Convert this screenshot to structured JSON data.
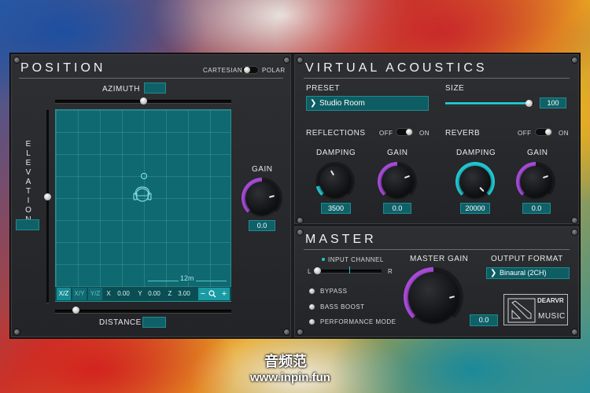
{
  "position": {
    "title": "POSITION",
    "mode_left": "CARTESIAN",
    "mode_right": "POLAR",
    "azimuth_label": "AZIMUTH",
    "azimuth_value": "",
    "elevation_label": "ELEVATION",
    "elevation_value": "",
    "distance_label": "DISTANCE",
    "distance_value": "",
    "gain_label": "GAIN",
    "gain_value": "0.0",
    "grid_scale": "12m",
    "view_buttons": [
      "X/Z",
      "X/Y",
      "Y/Z"
    ],
    "x_label": "X",
    "x_value": "0.00",
    "y_label": "Y",
    "y_value": "0.00",
    "z_label": "Z",
    "z_value": "3.00",
    "zoom_minus": "−",
    "zoom_icon": "magnifier-icon",
    "zoom_plus": "+"
  },
  "acoustics": {
    "title": "VIRTUAL ACOUSTICS",
    "preset_label": "PRESET",
    "preset_value": "Studio Room",
    "size_label": "SIZE",
    "size_value": "100",
    "size_fraction": 0.95,
    "reflections_label": "REFLECTIONS",
    "reverb_label": "REVERB",
    "off_label": "OFF",
    "on_label": "ON",
    "refl_damping_label": "DAMPING",
    "refl_damping_value": "3500",
    "refl_gain_label": "GAIN",
    "refl_gain_value": "0.0",
    "rev_damping_label": "DAMPING",
    "rev_damping_value": "20000",
    "rev_gain_label": "GAIN",
    "rev_gain_value": "0.0"
  },
  "master": {
    "title": "MASTER",
    "input_channel_label": "INPUT CHANNEL",
    "l_label": "L",
    "r_label": "R",
    "bypass_label": "BYPASS",
    "bass_boost_label": "BASS BOOST",
    "performance_label": "PERFORMANCE MODE",
    "master_gain_label": "MASTER GAIN",
    "master_gain_value": "0.0",
    "output_format_label": "OUTPUT FORMAT",
    "output_format_value": "Binaural (2CH)",
    "logo_top": "DEARVR",
    "logo_bottom": "MUSIC"
  },
  "watermark": {
    "line1": "音频范",
    "line2": "www.inpin.fun"
  },
  "colors": {
    "accent_teal": "#1f8a92",
    "knob_teal": "#22c6cf",
    "knob_purple": "#a64bd6"
  }
}
